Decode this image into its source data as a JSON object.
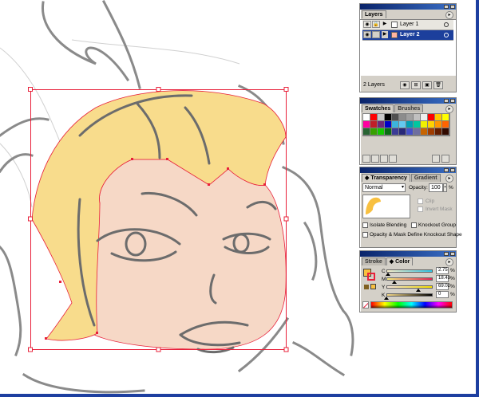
{
  "colors": {
    "hair_fill": "#f8dc8c",
    "skin_fill": "#f6d8c6",
    "sketch_line": "#808080",
    "selection": "#e8203a",
    "title_bar": "#0a246a",
    "layer_selected": "#1c3f9c",
    "panel_face": "#d4d0c8"
  },
  "layers_panel": {
    "tab": "Layers",
    "layers": [
      {
        "name": "Layer 1",
        "selected": false,
        "swatch": "#ffffff"
      },
      {
        "name": "Layer 2",
        "selected": true,
        "swatch": "#ffb4a0"
      }
    ],
    "count_text": "2 Layers",
    "footer_icons": [
      "new-sublayer-icon",
      "new-layer-icon",
      "trash-icon"
    ]
  },
  "swatches_panel": {
    "tabs": [
      "Swatches",
      "Brushes"
    ],
    "swatches": [
      "#ffffff",
      "#ff0000",
      "#c8c8c8",
      "#000000",
      "#505050",
      "#8c8c8c",
      "#a0a0a0",
      "#c0c0c0",
      "#eeeeee",
      "#ff0000",
      "#ffc800",
      "#ffff00",
      "#ff00a0",
      "#c01e28",
      "#6e2878",
      "#0000c8",
      "#3cb4dc",
      "#64c8f0",
      "#00a0b4",
      "#00c8a0",
      "#f0f000",
      "#ffd200",
      "#ff9600",
      "#ff6400",
      "#286432",
      "#38a000",
      "#14c800",
      "#0a6e14",
      "#3c3c96",
      "#282878",
      "#4650c8",
      "#6e6ea0",
      "#c86400",
      "#a03c00",
      "#641e00",
      "#320a00"
    ]
  },
  "transparency_panel": {
    "tabs": [
      "Transparency",
      "Gradient"
    ],
    "blend_mode": "Normal",
    "opacity_label": "Opacity:",
    "opacity_value": "100",
    "opacity_unit": "%",
    "clip_label": "Clip",
    "invert_mask_label": "Invert Mask",
    "isolate_label": "Isolate Blending",
    "knockout_label": "Knockout Group",
    "opacity_mask_label": "Opacity & Mask Define Knockout Shape"
  },
  "color_panel": {
    "tabs": [
      "Stroke",
      "Color"
    ],
    "channels": [
      {
        "label": "C",
        "value": "2.75",
        "unit": "%",
        "percent": 2.75,
        "track": "linear-gradient(to right,#fff2cc,#30c8e8)"
      },
      {
        "label": "M",
        "value": "18.43",
        "unit": "%",
        "percent": 18.43,
        "track": "linear-gradient(to right,#f8f080,#e82858)"
      },
      {
        "label": "Y",
        "value": "69.02",
        "unit": "%",
        "percent": 69.02,
        "track": "linear-gradient(to right,#f8e8e0,#f8e000)"
      },
      {
        "label": "K",
        "value": "0",
        "unit": "%",
        "percent": 0,
        "track": "linear-gradient(to right,#f8dc8c,#000000)"
      }
    ],
    "fill_color": "#f8c040"
  }
}
